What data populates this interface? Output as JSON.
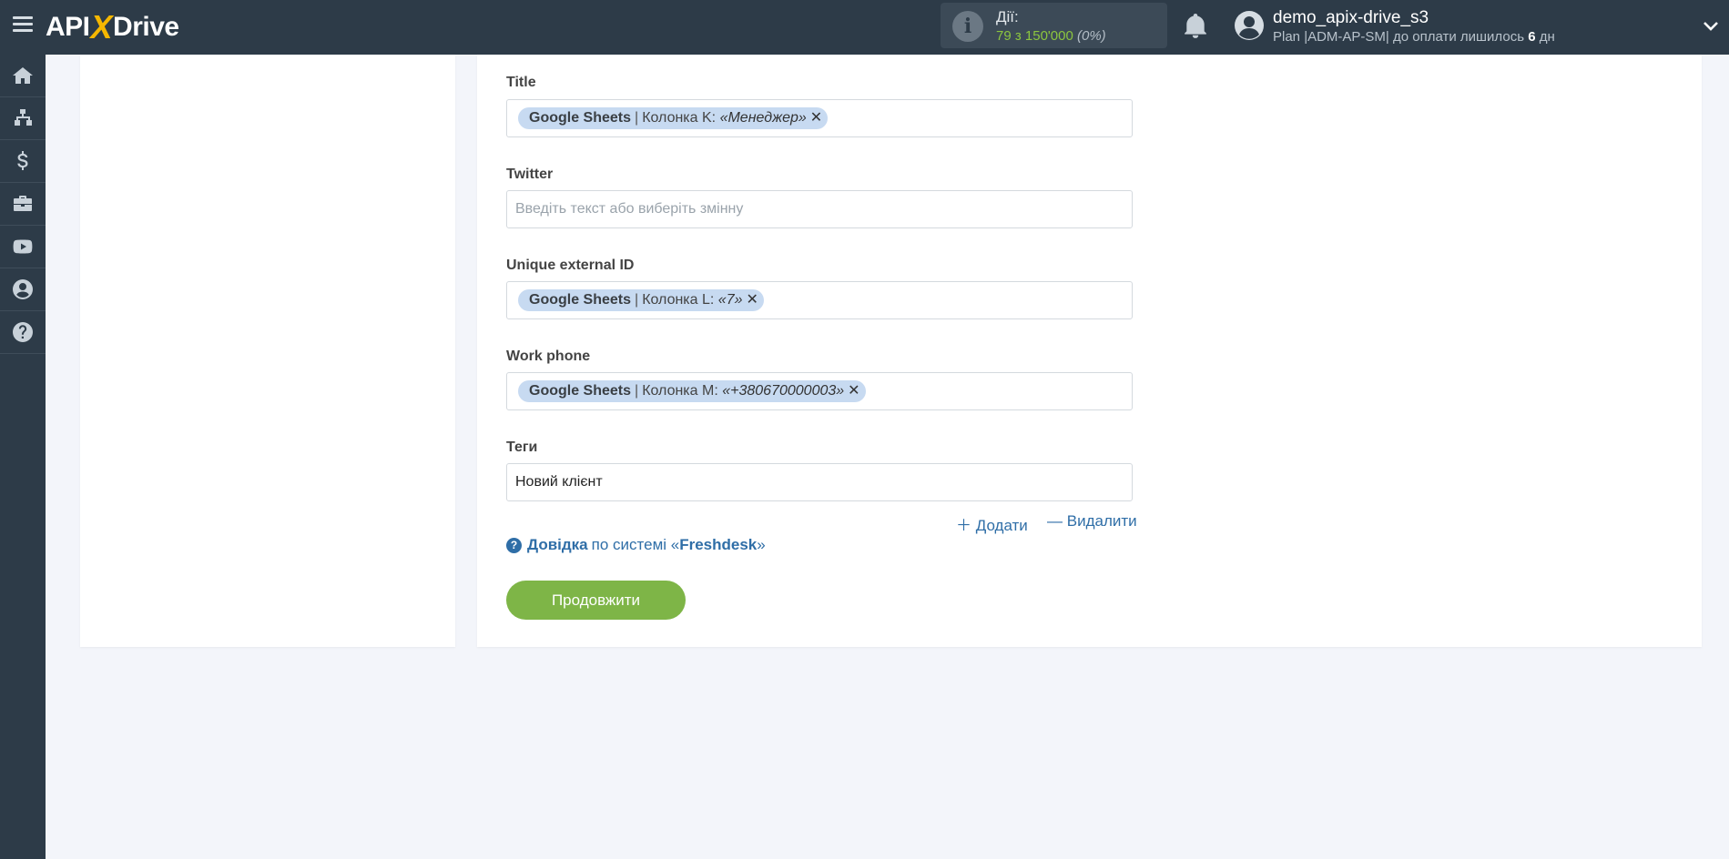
{
  "header": {
    "logo_left": "API",
    "logo_x": "X",
    "logo_right": "Drive",
    "actions_label": "Дії:",
    "actions_count": "79 з 150'000",
    "actions_percent": "(0%)",
    "user_name": "demo_apix-drive_s3",
    "user_plan": "Plan |ADM-AP-SM| до оплати лишилось",
    "user_days": "6",
    "user_days_unit": "дн"
  },
  "sidebar": {
    "items": [
      "home-icon",
      "sitemap-icon",
      "dollar-icon",
      "briefcase-icon",
      "youtube-icon",
      "user-circle-icon",
      "question-circle-icon"
    ]
  },
  "form": {
    "title": {
      "label": "Title",
      "tag_source": "Google Sheets",
      "tag_column": "Колонка K:",
      "tag_value": "«Менеджер»"
    },
    "twitter": {
      "label": "Twitter",
      "placeholder": "Введіть текст або виберіть змінну"
    },
    "unique_id": {
      "label": "Unique external ID",
      "tag_source": "Google Sheets",
      "tag_column": "Колонка L:",
      "tag_value": "«7»"
    },
    "work_phone": {
      "label": "Work phone",
      "tag_source": "Google Sheets",
      "tag_column": "Колонка M:",
      "tag_value": "«+380670000003»"
    },
    "tags": {
      "label": "Теги",
      "value": "Новий клієнт"
    },
    "add_label": "Додати",
    "remove_label": "Видалити",
    "help_strong": "Довідка",
    "help_text": "по системі «",
    "help_system": "Freshdesk",
    "help_end": "»",
    "continue_label": "Продовжити"
  },
  "colors": {
    "topbar": "#2d3b48",
    "accent_green": "#7eb547",
    "link_blue": "#2f6ea7",
    "tag_bg": "#c7daf1"
  }
}
